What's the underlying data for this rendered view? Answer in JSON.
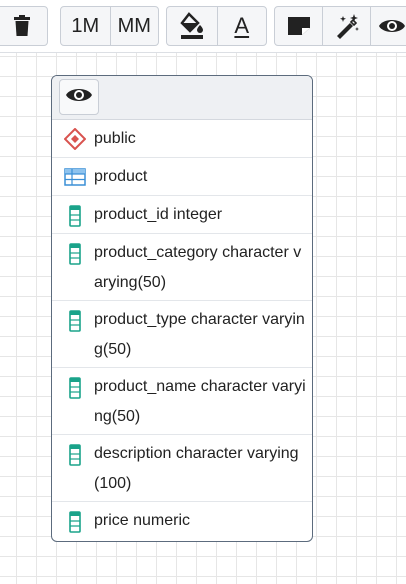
{
  "toolbar": {
    "buttons": [
      {
        "name": "delete-button",
        "icon": "trash-icon"
      },
      {
        "name": "one-to-many-button",
        "label": "1M"
      },
      {
        "name": "many-to-many-button",
        "label": "MM"
      },
      {
        "name": "fill-color-button",
        "icon": "paint-bucket-icon"
      },
      {
        "name": "text-color-button",
        "icon": "text-color-icon",
        "label": "A"
      },
      {
        "name": "note-button",
        "icon": "note-icon"
      },
      {
        "name": "auto-align-button",
        "icon": "magic-wand-icon"
      },
      {
        "name": "show-details-button",
        "icon": "eye-icon"
      }
    ]
  },
  "table_node": {
    "header_icon": "eye-icon",
    "schema": {
      "icon": "schema-icon",
      "label": "public"
    },
    "table": {
      "icon": "table-icon",
      "label": "product"
    },
    "columns": [
      {
        "icon": "column-icon",
        "label": "product_id integer"
      },
      {
        "icon": "column-icon",
        "label": "product_category character varying(50)"
      },
      {
        "icon": "column-icon",
        "label": "product_type character varying(50)"
      },
      {
        "icon": "column-icon",
        "label": "product_name character varying(50)"
      },
      {
        "icon": "column-icon",
        "label": "description character varying(100)"
      },
      {
        "icon": "column-icon",
        "label": "price numeric"
      }
    ]
  },
  "colors": {
    "schema_icon": "#d9534f",
    "table_icon": "#3a8fd6",
    "column_icon": "#1aa38a",
    "node_border": "#5c6b7d"
  }
}
